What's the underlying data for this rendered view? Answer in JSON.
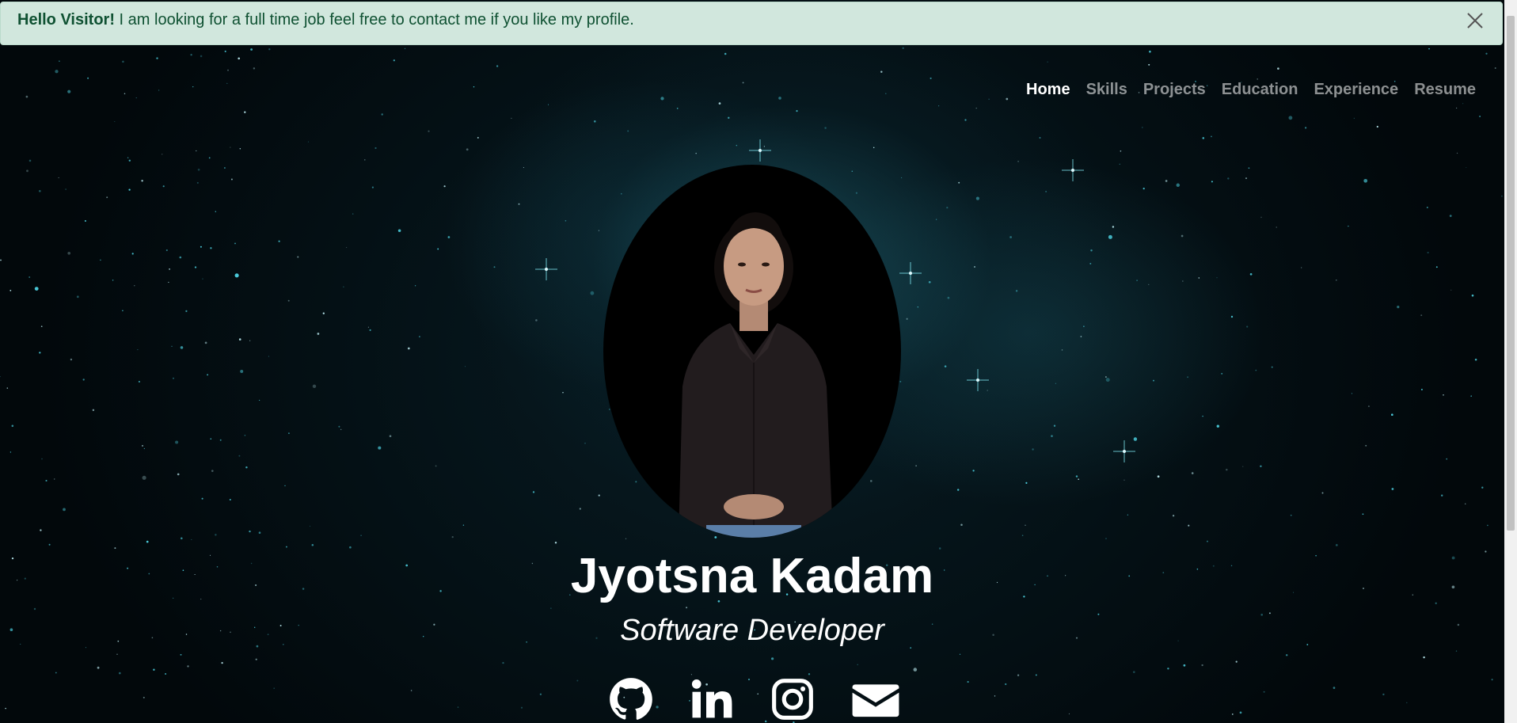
{
  "alert": {
    "bold_text": "Hello Visitor!",
    "message": " I am looking for a full time job feel free to contact me if you like my profile."
  },
  "nav": {
    "items": [
      {
        "label": "Home",
        "active": true
      },
      {
        "label": "Skills",
        "active": false
      },
      {
        "label": "Projects",
        "active": false
      },
      {
        "label": "Education",
        "active": false
      },
      {
        "label": "Experience",
        "active": false
      },
      {
        "label": "Resume",
        "active": false
      }
    ]
  },
  "hero": {
    "name": "Jyotsna Kadam",
    "role": "Software Developer"
  },
  "socials": {
    "icons": [
      "github-icon",
      "linkedin-icon",
      "instagram-icon",
      "envelope-icon"
    ]
  },
  "colors": {
    "alert_bg": "#d1e7dd",
    "alert_text": "#0f5132",
    "nav_active": "#ffffff",
    "nav_inactive": "#8c8c8c",
    "background": "#02080b"
  }
}
